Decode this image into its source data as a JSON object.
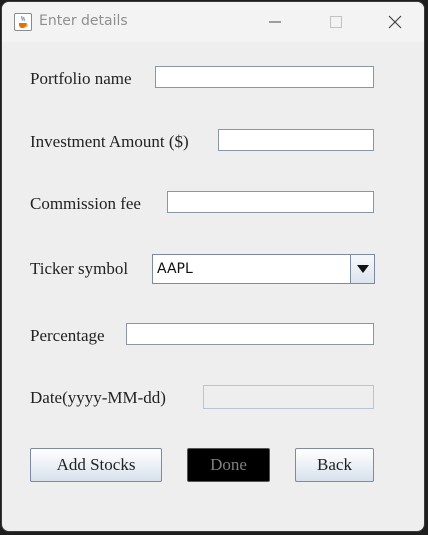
{
  "window": {
    "title": "Enter details",
    "app_icon": "java-cup-icon",
    "controls": [
      "minimize-icon",
      "maximize-icon",
      "close-icon"
    ]
  },
  "form": {
    "portfolio_name": {
      "label": "Portfolio name",
      "value": ""
    },
    "investment_amount": {
      "label": "Investment Amount ($)",
      "value": ""
    },
    "commission_fee": {
      "label": "Commission fee",
      "value": ""
    },
    "ticker_symbol": {
      "label": "Ticker symbol",
      "selected": "AAPL"
    },
    "percentage": {
      "label": "Percentage",
      "value": ""
    },
    "date": {
      "label": "Date(yyyy-MM-dd)",
      "value": ""
    }
  },
  "buttons": {
    "add_stocks": "Add Stocks",
    "done": "Done",
    "back": "Back"
  },
  "colors": {
    "window_bg": "#eeeeee",
    "done_bg": "#000000",
    "field_border": "#8a96a6"
  }
}
